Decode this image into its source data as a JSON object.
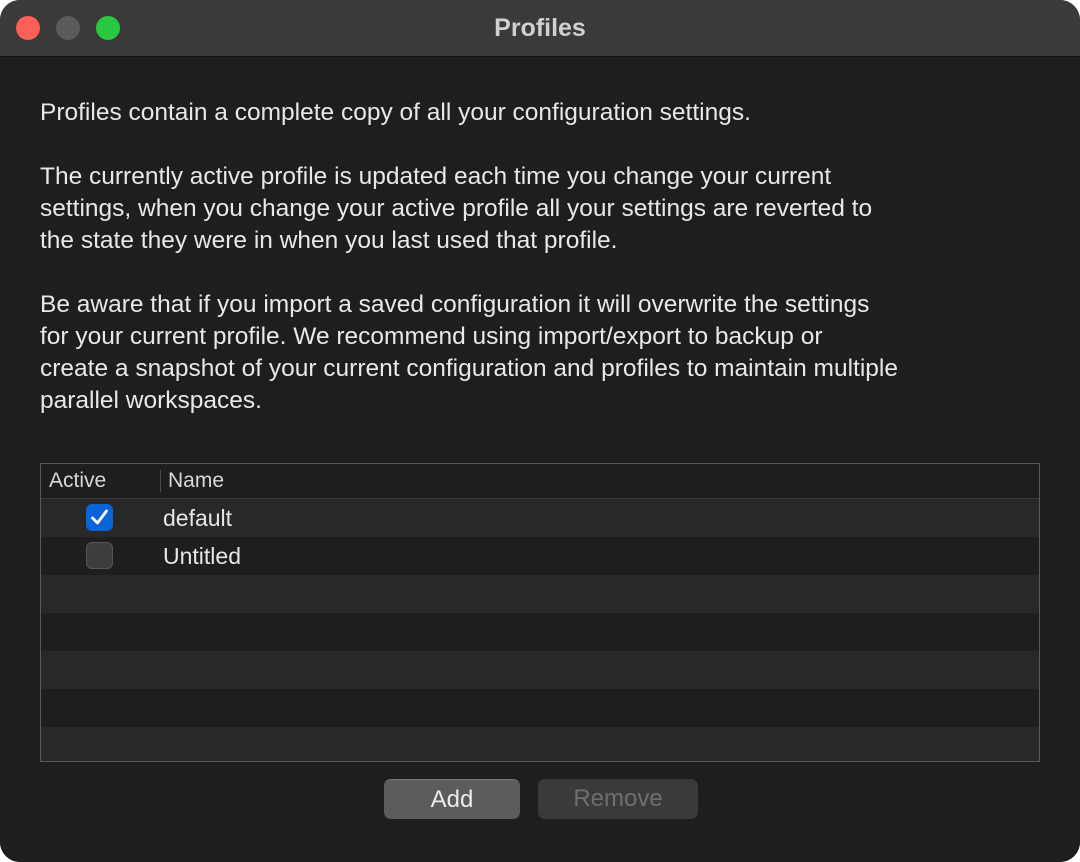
{
  "window": {
    "title": "Profiles"
  },
  "description": {
    "p1": "Profiles contain a complete copy of all your configuration settings.",
    "p2": "The currently active profile is updated each time you change your current\nsettings, when you change your active profile all your settings are reverted to\nthe state they were in when you last used that profile.",
    "p3": "Be aware that if you import a saved configuration it will overwrite the settings\nfor your current profile.  We recommend using import/export to backup or\ncreate a snapshot of your current configuration and profiles to maintain multiple\nparallel workspaces."
  },
  "table": {
    "columns": {
      "active": "Active",
      "name": "Name"
    },
    "rows": [
      {
        "active": true,
        "name": "default"
      },
      {
        "active": false,
        "name": "Untitled"
      }
    ]
  },
  "buttons": {
    "add": "Add",
    "remove": "Remove",
    "remove_enabled": false
  },
  "colors": {
    "accent": "#0a64d8",
    "close": "#fe5f57",
    "zoom": "#28c840"
  },
  "icons": {
    "checkmark": "checkmark-icon"
  }
}
